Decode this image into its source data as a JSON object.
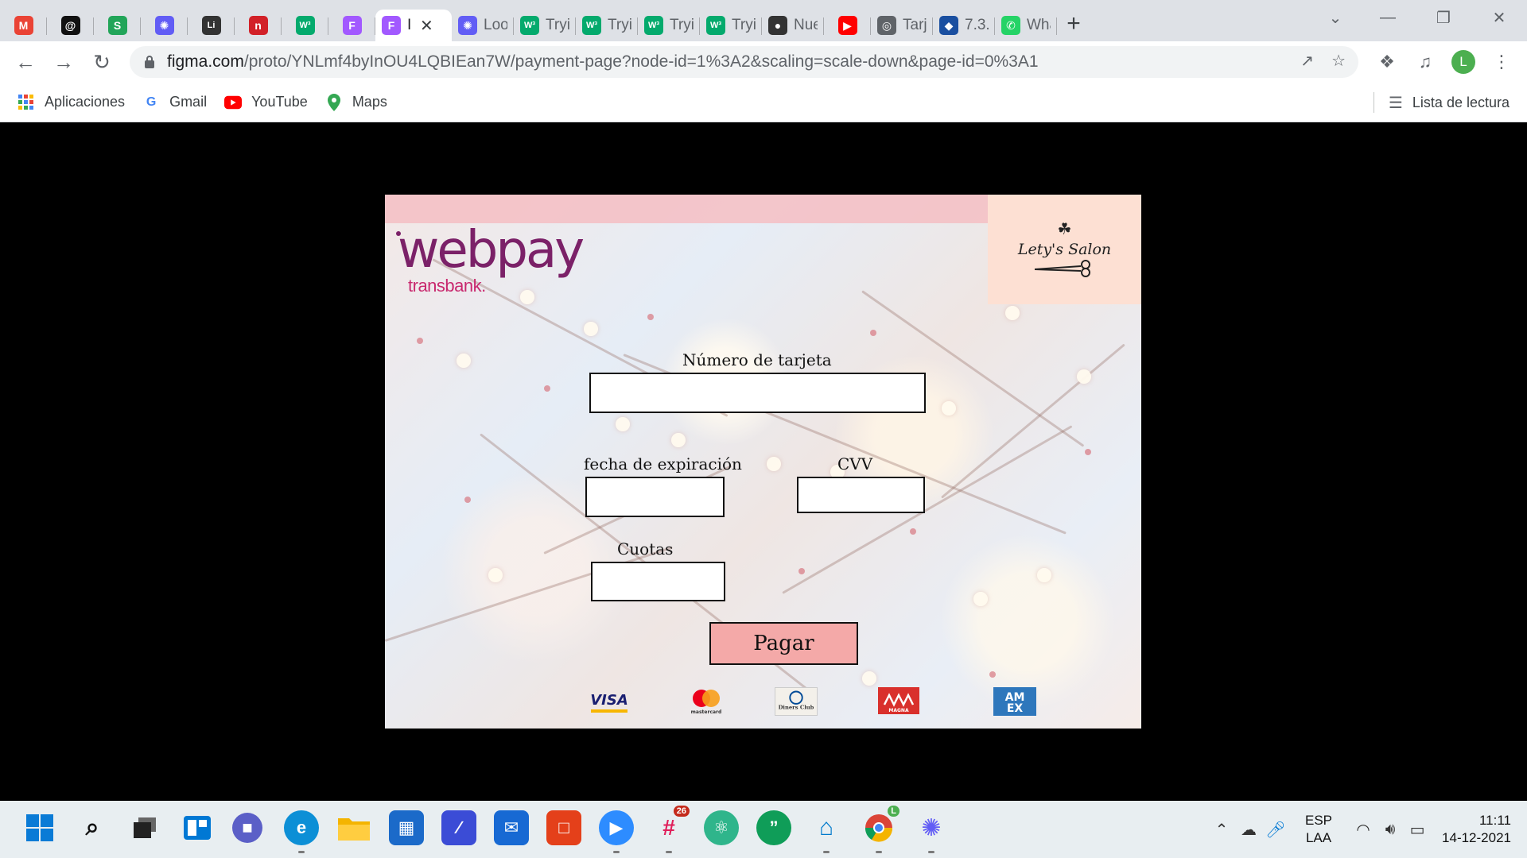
{
  "browser": {
    "tabs": [
      {
        "name": "gmail",
        "title": "",
        "icon": "gmail-icon",
        "color": "#ea4335"
      },
      {
        "name": "threads",
        "title": "",
        "icon": "spiral-icon",
        "color": "#111111"
      },
      {
        "name": "s-app",
        "title": "",
        "icon": "s-icon",
        "color": "#22a559"
      },
      {
        "name": "loom-1",
        "title": "",
        "icon": "loom-icon",
        "color": "#625df5"
      },
      {
        "name": "lit",
        "title": "",
        "icon": "lit-icon",
        "color": "#333333"
      },
      {
        "name": "netlify",
        "title": "",
        "icon": "n-icon",
        "color": "#d22128"
      },
      {
        "name": "w3-1",
        "title": "",
        "icon": "w3-icon",
        "color": "#04aa6d"
      },
      {
        "name": "figma-1",
        "title": "",
        "icon": "figma-icon",
        "color": "#a259ff"
      },
      {
        "name": "figma-active",
        "title": "I",
        "icon": "figma-icon",
        "color": "#a259ff",
        "active": true
      },
      {
        "name": "loom-2",
        "title": "Loo",
        "icon": "loom-icon",
        "color": "#625df5"
      },
      {
        "name": "w3-2",
        "title": "Tryit",
        "icon": "w3-icon",
        "color": "#04aa6d"
      },
      {
        "name": "w3-3",
        "title": "Tryit",
        "icon": "w3-icon",
        "color": "#04aa6d"
      },
      {
        "name": "w3-4",
        "title": "Tryit",
        "icon": "w3-icon",
        "color": "#04aa6d"
      },
      {
        "name": "w3-5",
        "title": "Tryit",
        "icon": "w3-icon",
        "color": "#04aa6d"
      },
      {
        "name": "github",
        "title": "Nue",
        "icon": "github-icon",
        "color": "#333333"
      },
      {
        "name": "youtube",
        "title": "",
        "icon": "youtube-icon",
        "color": "#ff0000"
      },
      {
        "name": "globe",
        "title": "Tarje",
        "icon": "globe-icon",
        "color": "#5f6368"
      },
      {
        "name": "seven",
        "title": "7.3.",
        "icon": "diamond-icon",
        "color": "#1a4fa0"
      },
      {
        "name": "whatsapp",
        "title": "Wha",
        "icon": "whatsapp-icon",
        "color": "#25d366"
      }
    ],
    "url_domain": "figma.com",
    "url_path": "/proto/YNLmf4byInOU4LQBIEan7W/payment-page?node-id=1%3A2&scaling=scale-down&page-id=0%3A1",
    "avatar_letter": "L",
    "bookmarks": [
      {
        "label": "Aplicaciones",
        "icon": "apps-grid-icon"
      },
      {
        "label": "Gmail",
        "icon": "google-icon"
      },
      {
        "label": "YouTube",
        "icon": "youtube-icon"
      },
      {
        "label": "Maps",
        "icon": "maps-pin-icon"
      }
    ],
    "reading_list": "Lista de lectura"
  },
  "payment": {
    "brand": "webpay",
    "brand_sub": "transbank.",
    "salon_name": "Lety's Salon",
    "card_number_label": "Número de tarjeta",
    "card_number_value": "",
    "expiry_label": "fecha de expiración",
    "expiry_value": "",
    "cvv_label": "CVV",
    "cvv_value": "",
    "installments_label": "Cuotas",
    "installments_value": "",
    "pay_button": "Pagar",
    "cards": [
      {
        "label": "VISA",
        "icon": "visa-logo-icon",
        "color": "#1a1f71"
      },
      {
        "label": "mastercard",
        "icon": "mastercard-logo-icon",
        "color": "#eb001b"
      },
      {
        "label": "Diners Club",
        "icon": "diners-club-logo-icon",
        "color": "#004a97"
      },
      {
        "label": "MAGNA",
        "icon": "magna-logo-icon",
        "color": "#d9302c"
      },
      {
        "label": "AMEX",
        "icon": "amex-logo-icon",
        "color": "#2e77bc"
      }
    ]
  },
  "taskbar": {
    "slack_badge": "26",
    "chrome_badge": "L",
    "lang_top": "ESP",
    "lang_bottom": "LAA",
    "time": "11:11",
    "date": "14-12-2021"
  }
}
